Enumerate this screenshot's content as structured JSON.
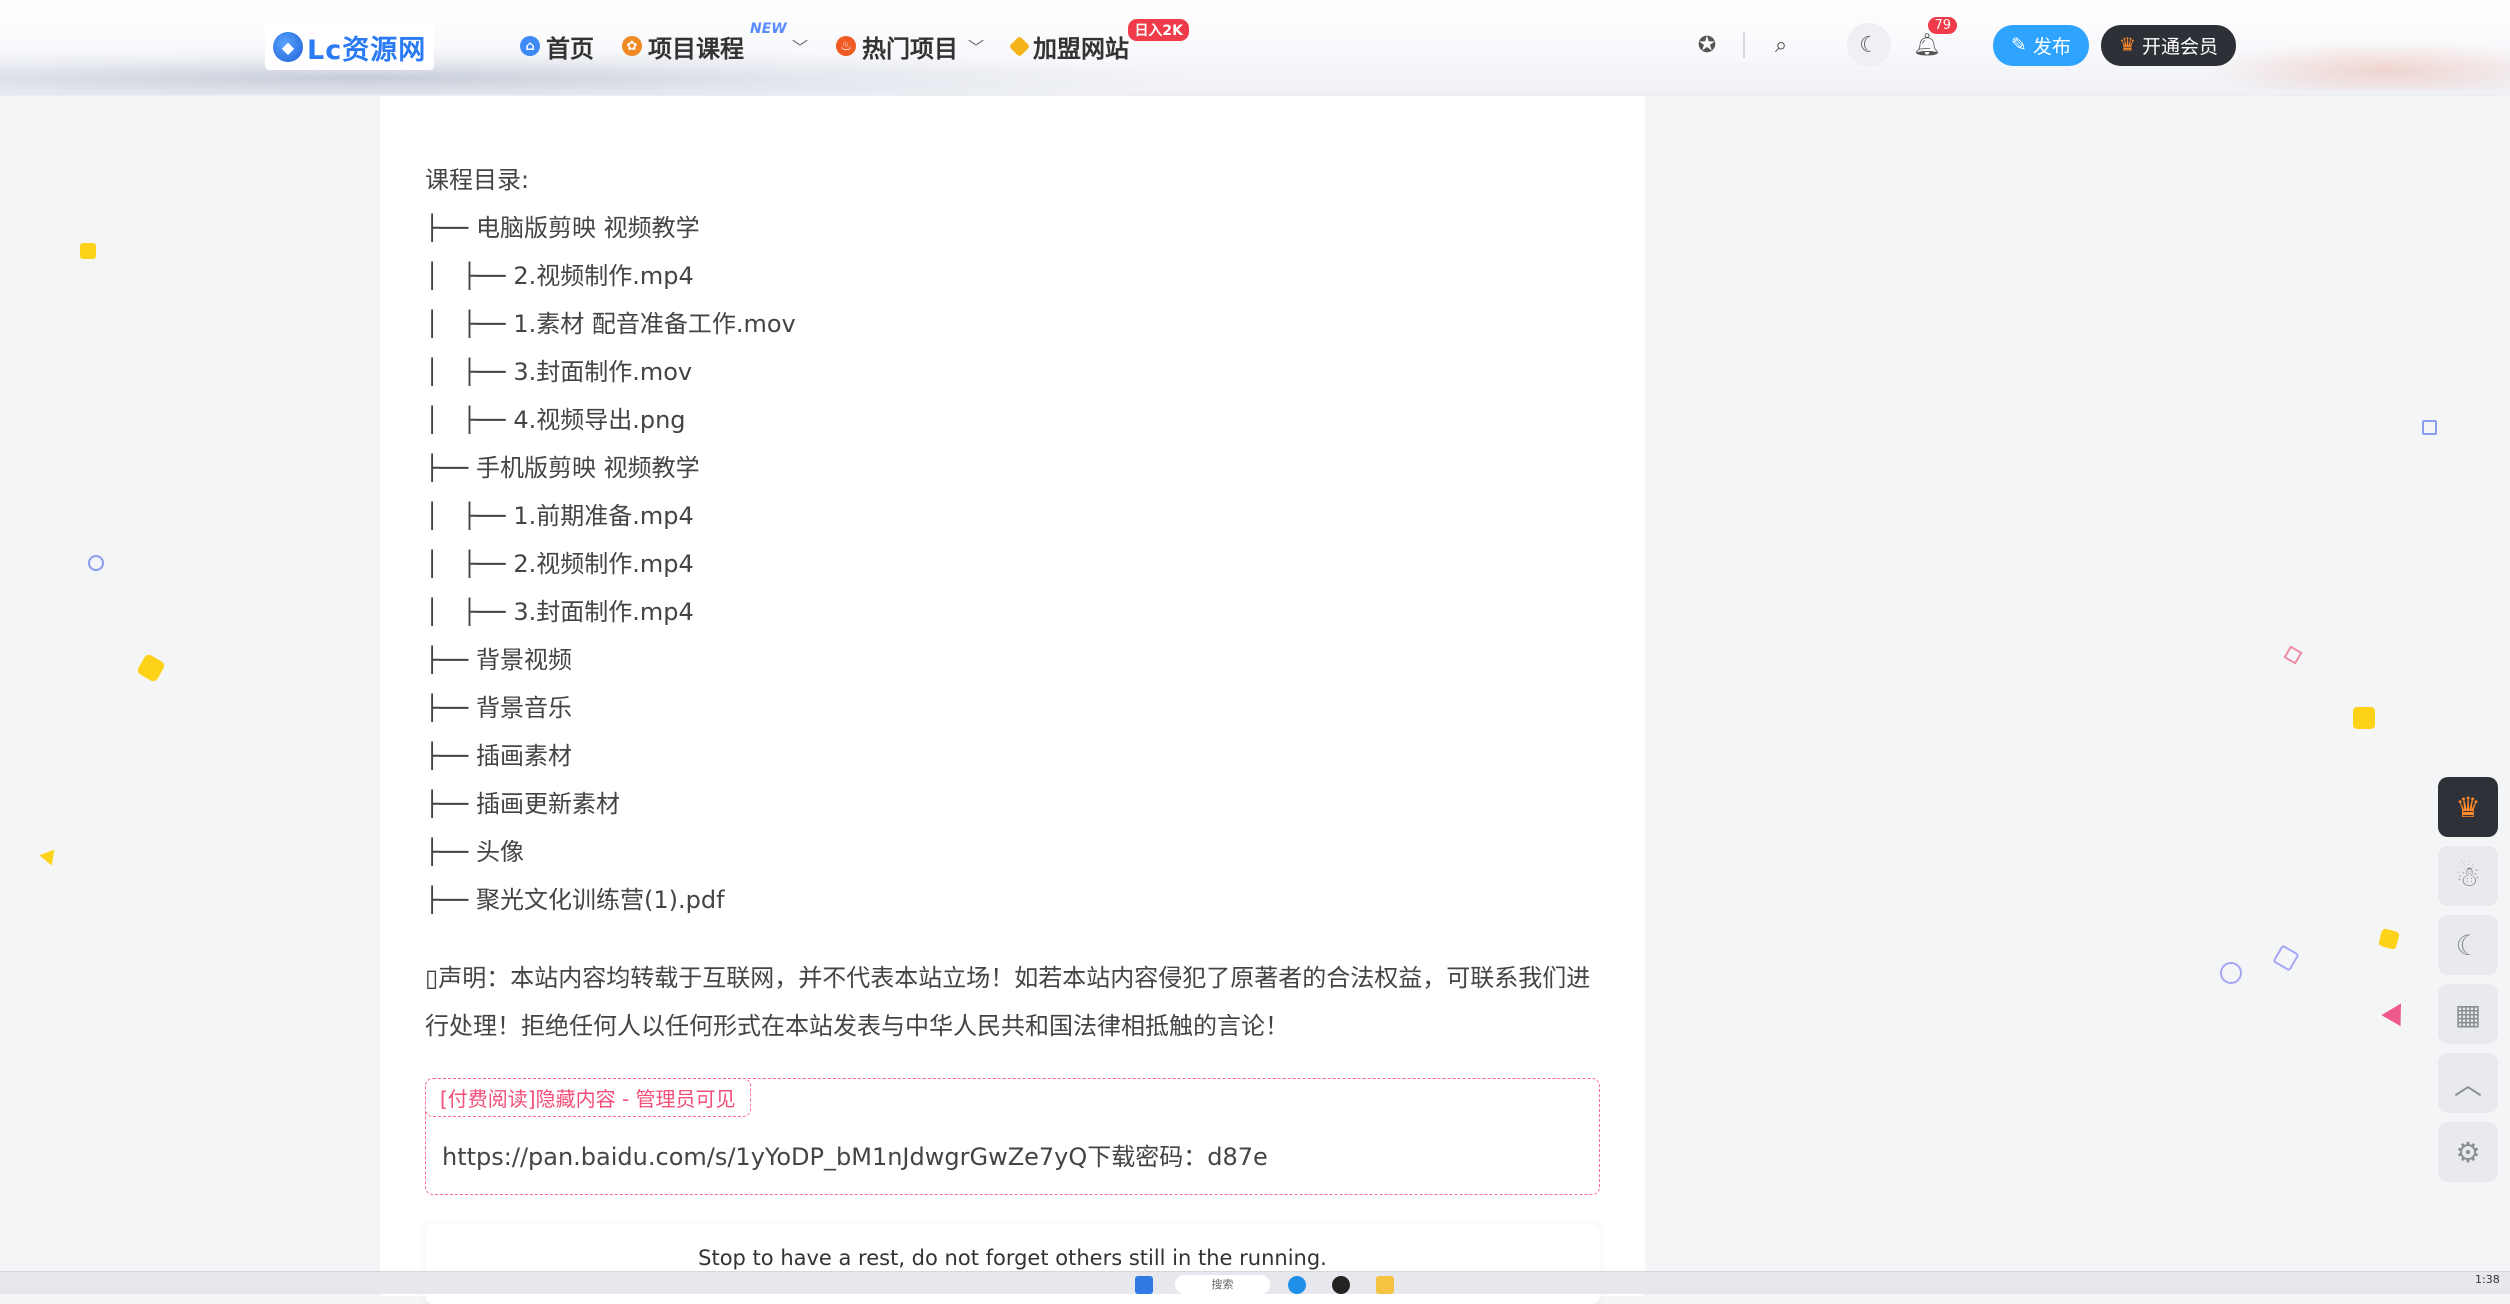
{
  "header": {
    "logo_text": "Lc资源网",
    "nav": [
      {
        "label": "首页"
      },
      {
        "label": "项目课程",
        "badge": "NEW"
      },
      {
        "label": "热门项目"
      },
      {
        "label": "加盟网站",
        "badge": "日入2K"
      }
    ],
    "notification_count": "79",
    "publish_label": "发布",
    "vip_label": "开通会员"
  },
  "content": {
    "toc": [
      "课程目录:",
      "├── 电脑版剪映 视频教学",
      "│   ├── 2.视频制作.mp4",
      "│   ├── 1.素材 配音准备工作.mov",
      "│   ├── 3.封面制作.mov",
      "│   ├── 4.视频导出.png",
      "├── 手机版剪映 视频教学",
      "│   ├── 1.前期准备.mp4",
      "│   ├── 2.视频制作.mp4",
      "│   ├── 3.封面制作.mp4",
      "├── 背景视频",
      "├── 背景音乐",
      "├── 插画素材",
      "├── 插画更新素材",
      "├── 头像",
      "├── 聚光文化训练营(1).pdf"
    ],
    "declaration": "▯声明：本站内容均转载于互联网，并不代表本站立场！如若本站内容侵犯了原著者的合法权益，可联系我们进行处理！拒绝任何人以任何形式在本站发表与中华人民共和国法律相抵触的言论！",
    "hidden_tag": "[付费阅读]隐藏内容 - 管理员可见",
    "hidden_link": "https://pan.baidu.com/s/1yYoDP_bM1nJdwgrGwZe7yQ下载密码：d87e",
    "footer_text": "Stop to have a rest, do not forget others still in the running."
  },
  "sidebar_icons": [
    "crown-icon",
    "qq-icon",
    "moon-icon",
    "qrcode-icon",
    "arrow-up-icon",
    "gear-icon"
  ],
  "taskbar": {
    "search_label": "搜索",
    "time": "1:38"
  },
  "colors": {
    "accent": "#2ea3ff",
    "dark_button": "#2e3038",
    "badge_red": "#ef3b4a",
    "hidden_border": "#ff6a8a"
  }
}
